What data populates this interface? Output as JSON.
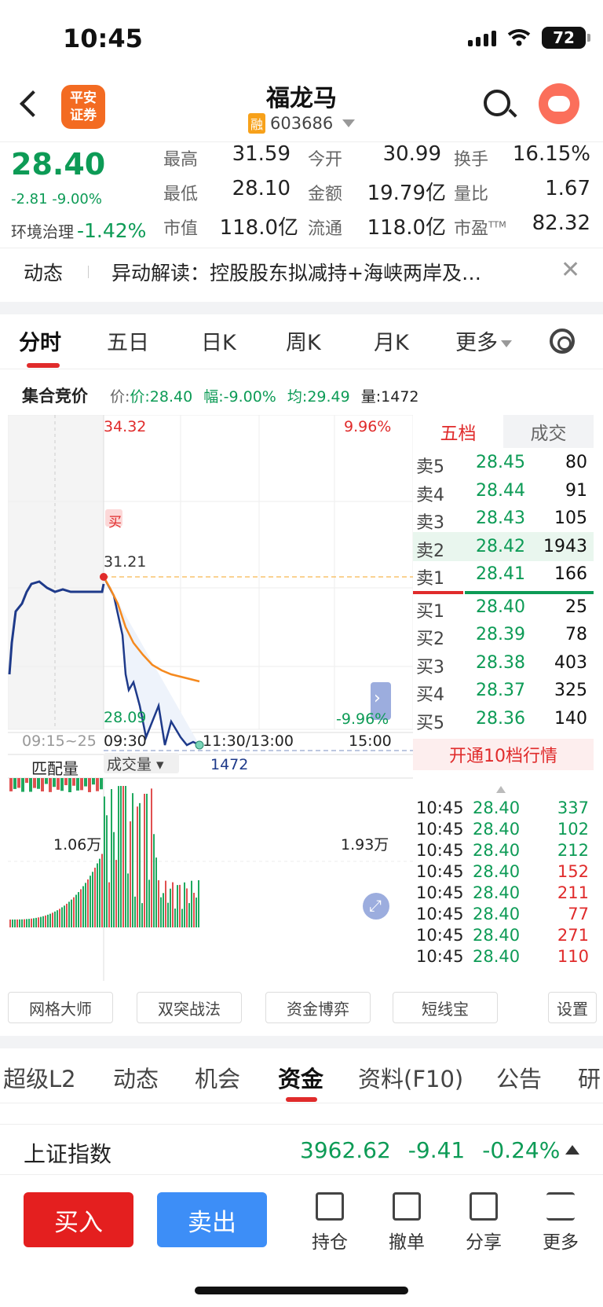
{
  "status": {
    "time": "10:45",
    "battery": "72"
  },
  "header": {
    "broker_logo": "平安\n证券",
    "stock_name": "福龙马",
    "rong_badge": "融",
    "stock_code": "603686"
  },
  "quote": {
    "price": "28.40",
    "change": "-2.81 -9.00%",
    "sector_name": "环境治理",
    "sector_change": "-1.42%",
    "fields": [
      {
        "label": "最高",
        "value": "31.59",
        "color": "#e02b2b"
      },
      {
        "label": "今开",
        "value": "30.99",
        "color": "#0d9b56"
      },
      {
        "label": "换手",
        "value": "16.15%",
        "color": "#222222"
      },
      {
        "label": "最低",
        "value": "28.10",
        "color": "#0d9b56"
      },
      {
        "label": "金额",
        "value": "19.79亿",
        "color": "#222222"
      },
      {
        "label": "量比",
        "value": "1.67",
        "color": "#222222"
      },
      {
        "label": "市值",
        "value": "118.0亿",
        "color": "#222222"
      },
      {
        "label": "流通",
        "value": "118.0亿",
        "color": "#222222"
      },
      {
        "label": "市盈",
        "value": "82.32",
        "color": "#222222"
      }
    ],
    "ttm": "TTM"
  },
  "news": {
    "label": "动态",
    "text": "异动解读：控股股东拟减持+海峡两岸及…"
  },
  "chart_tabs": [
    "分时",
    "五日",
    "日K",
    "周K",
    "月K",
    "更多"
  ],
  "auction": {
    "title": "集合竞价",
    "info_price": "价:28.40",
    "info_range": "幅:-9.00%",
    "info_avg": "均:29.49",
    "info_vol": "量:1472"
  },
  "chart": {
    "top_left": "34.32",
    "top_right": "9.96%",
    "buy_marker": "买",
    "high_label": "31.21",
    "bottom_left": "28.09",
    "bottom_right": "-9.96%",
    "time_auction": "09:15~25",
    "time_open": "09:30",
    "time_mid": "11:30/13:00",
    "time_close": "15:00",
    "match_label": "匹配量",
    "vol_label": "成交量",
    "vol_value": "1472",
    "vol_left": "1.06万",
    "vol_right": "1.93万"
  },
  "order_book": {
    "tab_five": "五档",
    "tab_trades": "成交",
    "rows": [
      {
        "name": "卖5",
        "price": "28.45",
        "vol": "80"
      },
      {
        "name": "卖4",
        "price": "28.44",
        "vol": "91"
      },
      {
        "name": "卖3",
        "price": "28.43",
        "vol": "105"
      },
      {
        "name": "卖2",
        "price": "28.42",
        "vol": "1943"
      },
      {
        "name": "卖1",
        "price": "28.41",
        "vol": "166"
      },
      {
        "name": "买1",
        "price": "28.40",
        "vol": "25"
      },
      {
        "name": "买2",
        "price": "28.39",
        "vol": "78"
      },
      {
        "name": "买3",
        "price": "28.38",
        "vol": "403"
      },
      {
        "name": "买4",
        "price": "28.37",
        "vol": "325"
      },
      {
        "name": "买5",
        "price": "28.36",
        "vol": "140"
      }
    ],
    "open10": "开通10档行情",
    "ticks": [
      {
        "t": "10:45",
        "p": "28.40",
        "v": "337",
        "c": "#0d9b56"
      },
      {
        "t": "10:45",
        "p": "28.40",
        "v": "102",
        "c": "#0d9b56"
      },
      {
        "t": "10:45",
        "p": "28.40",
        "v": "212",
        "c": "#0d9b56"
      },
      {
        "t": "10:45",
        "p": "28.40",
        "v": "152",
        "c": "#e02b2b"
      },
      {
        "t": "10:45",
        "p": "28.40",
        "v": "211",
        "c": "#e02b2b"
      },
      {
        "t": "10:45",
        "p": "28.40",
        "v": "77",
        "c": "#e02b2b"
      },
      {
        "t": "10:45",
        "p": "28.40",
        "v": "271",
        "c": "#e02b2b"
      },
      {
        "t": "10:45",
        "p": "28.40",
        "v": "110",
        "c": "#e02b2b"
      }
    ]
  },
  "tools": [
    "网格大师",
    "双突战法",
    "资金博弈",
    "短线宝",
    "设置"
  ],
  "bottom_tabs": [
    "超级L2",
    "动态",
    "机会",
    "资金",
    "资料(F10)",
    "公告",
    "研"
  ],
  "index": {
    "name": "上证指数",
    "value": "3962.62",
    "change": "-9.41",
    "pct": "-0.24%"
  },
  "actions": {
    "buy": "买入",
    "sell": "卖出",
    "hold": "持仓",
    "cancel": "撤单",
    "share": "分享",
    "more": "更多"
  },
  "chart_data": {
    "type": "line",
    "series": [
      {
        "values": [
          31.21,
          31.0,
          30.4,
          29.8,
          29.3,
          29.0,
          28.8,
          28.7,
          28.6,
          28.55,
          28.5,
          28.45
        ]
      },
      {
        "values": [
          31.59,
          30.5,
          29.5,
          28.9,
          29.2,
          28.6,
          28.8,
          28.2,
          28.3,
          28.1,
          28.4,
          28.3,
          28.2,
          28.4
        ]
      }
    ],
    "ylim": [
      28.09,
      34.32
    ]
  }
}
